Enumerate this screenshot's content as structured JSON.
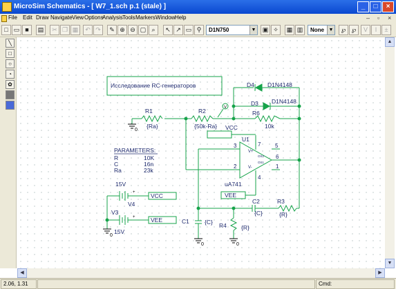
{
  "window": {
    "title": "MicroSim Schematics - [ W7_1.sch  p.1 (stale) ]"
  },
  "menu": [
    "File",
    "Edit",
    "Draw",
    "Navigate",
    "View",
    "Options",
    "Analysis",
    "Tools",
    "Markers",
    "Window",
    "Help"
  ],
  "toolbar": {
    "part_name": "D1N750",
    "marker_style": "None"
  },
  "schematic": {
    "title_box": "Исследование RC-генераторов",
    "components": {
      "R1": {
        "ref": "R1",
        "value": "{Ra}"
      },
      "R2": {
        "ref": "R2",
        "value": "{50k-Ra}"
      },
      "R6": {
        "ref": "R6",
        "value": "10k"
      },
      "D4": {
        "ref": "D4",
        "value": "D1N4148"
      },
      "D3": {
        "ref": "D3",
        "value": "D1N4148"
      },
      "U1": {
        "ref": "U1",
        "value": "uA741"
      },
      "C1": {
        "ref": "C1",
        "value": "{C}"
      },
      "C2": {
        "ref": "C2",
        "value": "{C}"
      },
      "R3": {
        "ref": "R3",
        "value": "{R}"
      },
      "R4": {
        "ref": "R4",
        "value": "{R}"
      },
      "V4": {
        "ref": "V4",
        "value": "15V"
      },
      "V3": {
        "ref": "V3",
        "value": "15V"
      }
    },
    "net_labels": {
      "vcc_top": "VCC",
      "vcc": "VCC",
      "vee": "VEE",
      "vee2": "VEE"
    },
    "pins": {
      "p7": "7",
      "p5": "5",
      "p6": "6",
      "p1": "1",
      "p3": "3",
      "p2": "2",
      "p4": "4",
      "vplus": "V+",
      "vminus": "V-",
      "os2": "OS2",
      "os1": "OS1"
    },
    "parameters": {
      "title": "PARAMETERS:",
      "rows": [
        {
          "name": "R",
          "value": "10K"
        },
        {
          "name": "C",
          "value": "16n"
        },
        {
          "name": "Ra",
          "value": "23k"
        }
      ]
    }
  },
  "status": {
    "coords": "2.06,  1.31",
    "cmd": "Cmd:"
  }
}
